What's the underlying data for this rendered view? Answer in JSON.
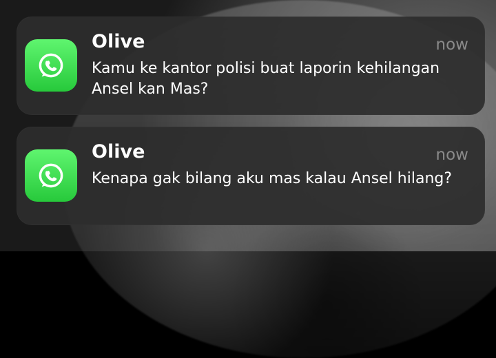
{
  "notifications": [
    {
      "app_icon": "whatsapp-icon",
      "sender": "Olive",
      "time": "now",
      "message": "Kamu ke kantor polisi buat laporin kehilangan Ansel kan Mas?"
    },
    {
      "app_icon": "whatsapp-icon",
      "sender": "Olive",
      "time": "now",
      "message": "Kenapa gak bilang aku mas kalau Ansel hilang?"
    }
  ],
  "colors": {
    "app_green": "#31d447",
    "notification_bg": "#2d2d2d",
    "time_text": "#8a8a8a",
    "text": "#ffffff"
  }
}
